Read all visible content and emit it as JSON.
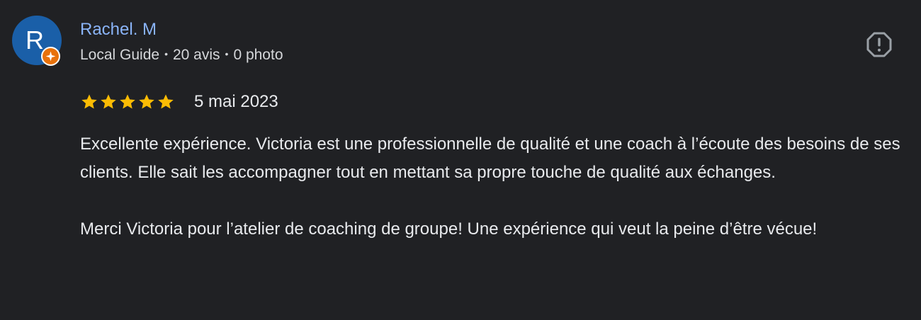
{
  "review": {
    "reviewer": {
      "initial": "R",
      "name": "Rachel. M",
      "badge": "Local Guide",
      "review_count": "20 avis",
      "photo_count": "0 photo",
      "avatar_color": "#1a5fa8",
      "badge_color": "#e8710a",
      "name_color": "#8ab4f8"
    },
    "rating": 5,
    "rating_max": 5,
    "star_color": "#fbbc04",
    "date": "5 mai 2023",
    "paragraphs": [
      "Excellente expérience. Victoria est une professionnelle de qualité et une coach à l’écoute des besoins de ses clients. Elle sait les accompagner tout en mettant sa propre touche de qualité aux échanges.",
      "Merci Victoria pour l’atelier de coaching de groupe! Une expérience qui veut la peine d’être vécue!"
    ],
    "report_icon": "report-flag-icon",
    "separator": "•"
  }
}
